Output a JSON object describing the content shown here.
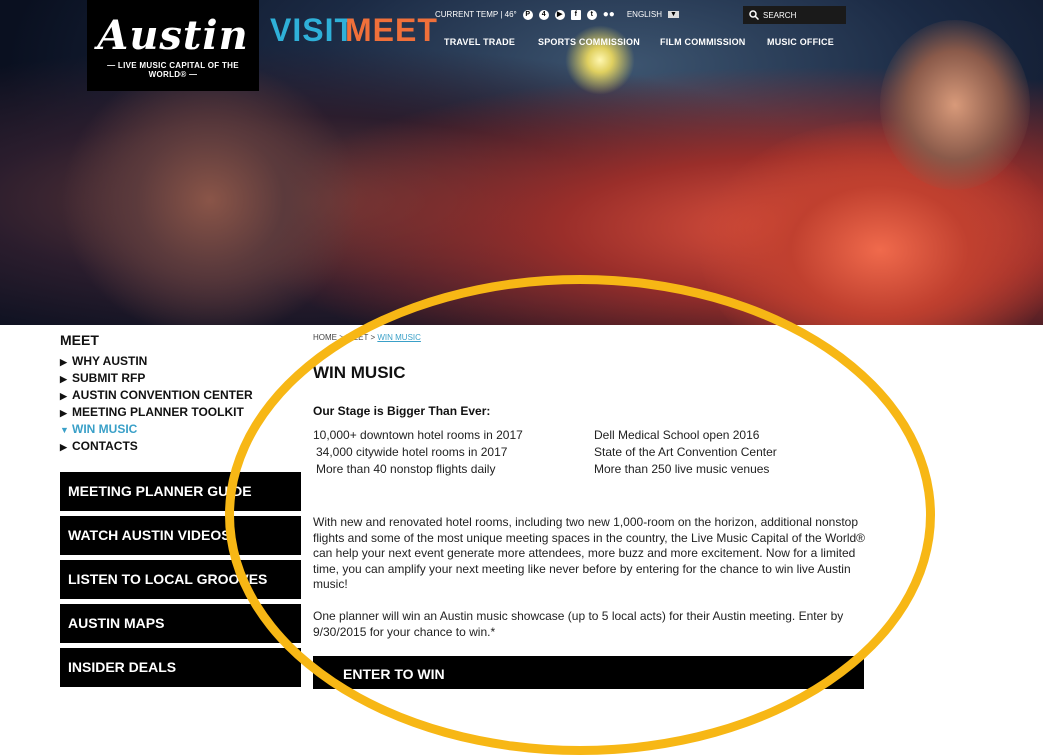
{
  "logo": {
    "script": "Austin",
    "tagline": "— LIVE MUSIC CAPITAL OF THE WORLD® —"
  },
  "nav": {
    "visit": "VISIT",
    "meet": "MEET"
  },
  "topbar": {
    "temp": "CURRENT TEMP | 46°",
    "social_icons": [
      "pinterest-icon",
      "foursquare-icon",
      "youtube-icon",
      "facebook-icon",
      "twitter-icon",
      "flickr-icon"
    ],
    "language": "ENGLISH",
    "search_placeholder": "SEARCH"
  },
  "subnav": [
    "TRAVEL TRADE",
    "SPORTS COMMISSION",
    "FILM COMMISSION",
    "MUSIC OFFICE"
  ],
  "sidebar": {
    "title": "MEET",
    "items": [
      {
        "label": "WHY AUSTIN",
        "active": false
      },
      {
        "label": "SUBMIT RFP",
        "active": false
      },
      {
        "label": "AUSTIN CONVENTION CENTER",
        "active": false
      },
      {
        "label": "MEETING PLANNER TOOLKIT",
        "active": false
      },
      {
        "label": "WIN MUSIC",
        "active": true
      },
      {
        "label": "CONTACTS",
        "active": false
      }
    ],
    "blocks": [
      "MEETING PLANNER GUIDE",
      "WATCH AUSTIN VIDEOS",
      "LISTEN TO LOCAL GROOVES",
      "AUSTIN MAPS",
      "INSIDER DEALS"
    ]
  },
  "breadcrumb": {
    "home": "HOME",
    "sep": ">",
    "meet": "MEET",
    "current": "WIN MUSIC"
  },
  "main": {
    "title": "WIN MUSIC",
    "subtitle": "Our Stage is Bigger Than Ever:",
    "facts_left": [
      "10,000+ downtown hotel rooms in 2017",
      "34,000 citywide hotel rooms in 2017",
      "More than 40 nonstop flights daily"
    ],
    "facts_right": [
      "Dell Medical School open 2016",
      "State of the Art Convention Center",
      "More than 250 live music venues"
    ],
    "paragraph1": "With new and renovated hotel rooms, including two new 1,000-room on the horizon, additional nonstop flights and some of the most unique meeting spaces in the country, the Live Music Capital of the World® can help your next event generate more attendees, more buzz and more excitement. Now for a limited time, you can amplify your next meeting like never before by entering for the chance to win live Austin music!",
    "paragraph2": "One planner will win an Austin music showcase (up to 5 local acts) for their Austin meeting. Enter by 9/30/2015 for your chance to win.*",
    "enter_button": "ENTER TO WIN"
  },
  "colors": {
    "visit": "#2fb0d8",
    "meet": "#f0703a",
    "highlight": "#f7b715",
    "active_link": "#3aa0c8"
  }
}
